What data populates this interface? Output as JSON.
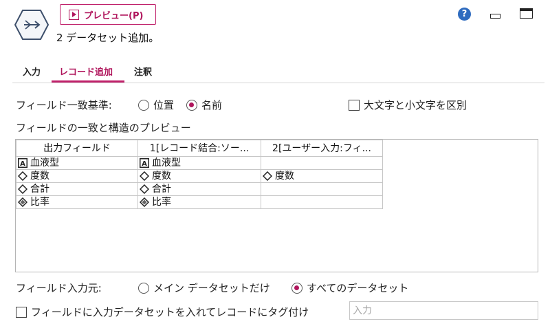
{
  "header": {
    "preview_label": "プレビュー(P)",
    "title": "2 データセット追加。",
    "help_glyph": "?",
    "node_icon": "append-node-icon",
    "accent_color": "#b0155c"
  },
  "tabs": [
    {
      "label": "入力",
      "active": false
    },
    {
      "label": "レコード追加",
      "active": true
    },
    {
      "label": "注釈",
      "active": false
    }
  ],
  "field_match": {
    "label": "フィールド一致基準:",
    "options": [
      {
        "label": "位置",
        "selected": false
      },
      {
        "label": "名前",
        "selected": true
      }
    ],
    "case_sensitive_label": "大文字と小文字を区別",
    "case_sensitive_checked": false
  },
  "preview_section_label": "フィールドの一致と構造のプレビュー",
  "table": {
    "columns": [
      "出力フィールド",
      "1[レコード結合:ソー...",
      "2[ユーザー入力:フィ..."
    ],
    "rows": [
      [
        {
          "icon": "string",
          "text": "血液型"
        },
        {
          "icon": "string",
          "text": "血液型"
        },
        {
          "icon": "",
          "text": ""
        }
      ],
      [
        {
          "icon": "continuous",
          "text": "度数"
        },
        {
          "icon": "continuous",
          "text": "度数"
        },
        {
          "icon": "continuous",
          "text": "度数"
        }
      ],
      [
        {
          "icon": "continuous",
          "text": "合計"
        },
        {
          "icon": "continuous",
          "text": "合計"
        },
        {
          "icon": "",
          "text": ""
        }
      ],
      [
        {
          "icon": "derived",
          "text": "比率"
        },
        {
          "icon": "derived",
          "text": "比率"
        },
        {
          "icon": "",
          "text": ""
        }
      ]
    ]
  },
  "field_source": {
    "label": "フィールド入力元:",
    "options": [
      {
        "label": "メイン データセットだけ",
        "selected": false
      },
      {
        "label": "すべてのデータセット",
        "selected": true
      }
    ]
  },
  "tag": {
    "label": "フィールドに入力データセットを入れてレコードにタグ付け",
    "checked": false,
    "input_placeholder": "入力"
  }
}
